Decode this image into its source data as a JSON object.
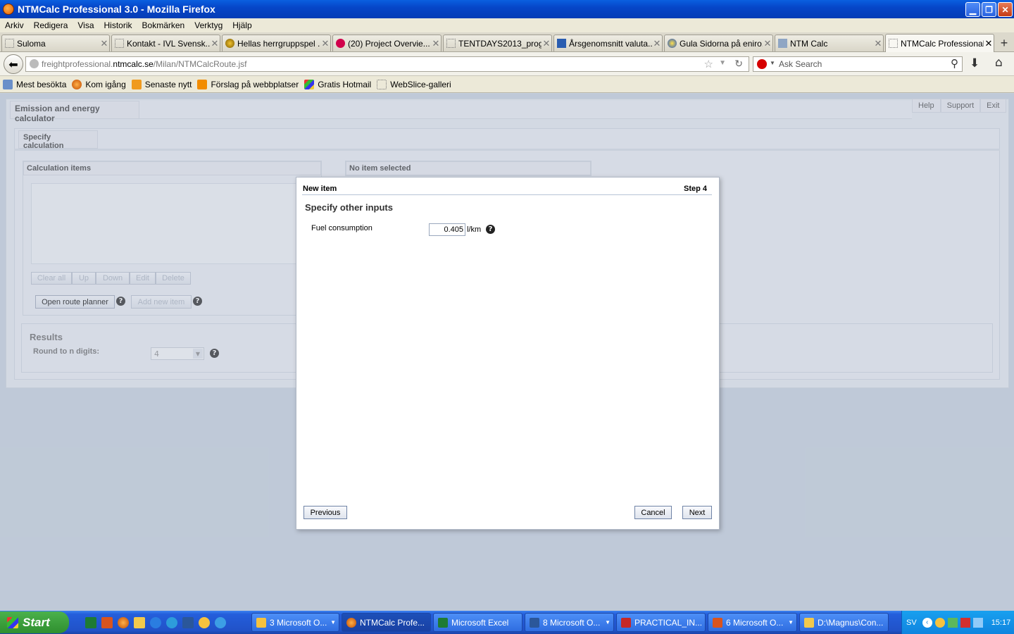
{
  "browser": {
    "title": "NTMCalc Professional 3.0 - Mozilla Firefox",
    "menu": [
      "Arkiv",
      "Redigera",
      "Visa",
      "Historik",
      "Bokmärken",
      "Verktyg",
      "Hjälp"
    ],
    "tabs": [
      {
        "label": "Suloma"
      },
      {
        "label": "Kontakt - IVL Svensk..."
      },
      {
        "label": "Hellas herrgruppspel ..."
      },
      {
        "label": "(20) Project Overvie..."
      },
      {
        "label": "TENTDAYS2013_prog..."
      },
      {
        "label": "Årsgenomsnitt valuta..."
      },
      {
        "label": "Gula Sidorna på eniro..."
      },
      {
        "label": "NTM Calc"
      },
      {
        "label": "NTMCalc Professional..."
      }
    ],
    "url_prefix": "freightprofessional.",
    "url_domain": "ntmcalc.se",
    "url_path": "/Milan/NTMCalcRoute.jsf",
    "search_placeholder": "Ask Search",
    "bookmarks": [
      "Mest besökta",
      "Kom igång",
      "Senaste nytt",
      "Förslag på webbplatser",
      "Gratis Hotmail",
      "WebSlice-galleri"
    ]
  },
  "app": {
    "header_tab": "Emission and energy calculator",
    "top_links": [
      "Help",
      "Support",
      "Exit"
    ],
    "specify_tab": "Specify calculation",
    "calc_items_title": "Calculation items",
    "no_item_title": "No item selected",
    "list_buttons": [
      "Clear all",
      "Up",
      "Down",
      "Edit",
      "Delete"
    ],
    "open_route_planner": "Open route planner",
    "add_new_item": "Add new item",
    "results_title": "Results",
    "round_label": "Round to n digits:",
    "round_value": "4"
  },
  "dialog": {
    "title": "New item",
    "step": "Step 4",
    "heading": "Specify other inputs",
    "field_label": "Fuel consumption",
    "field_value": "0.405",
    "field_unit": "l/km",
    "previous": "Previous",
    "cancel": "Cancel",
    "next": "Next"
  },
  "taskbar": {
    "start": "Start",
    "tasks": [
      {
        "label": "3 Microsoft O..."
      },
      {
        "label": "NTMCalc Profe..."
      },
      {
        "label": "Microsoft Excel"
      },
      {
        "label": "8 Microsoft O..."
      },
      {
        "label": "PRACTICAL_IN..."
      },
      {
        "label": "6 Microsoft O..."
      },
      {
        "label": "D:\\Magnus\\Con..."
      }
    ],
    "lang": "SV",
    "clock": "15:17"
  }
}
